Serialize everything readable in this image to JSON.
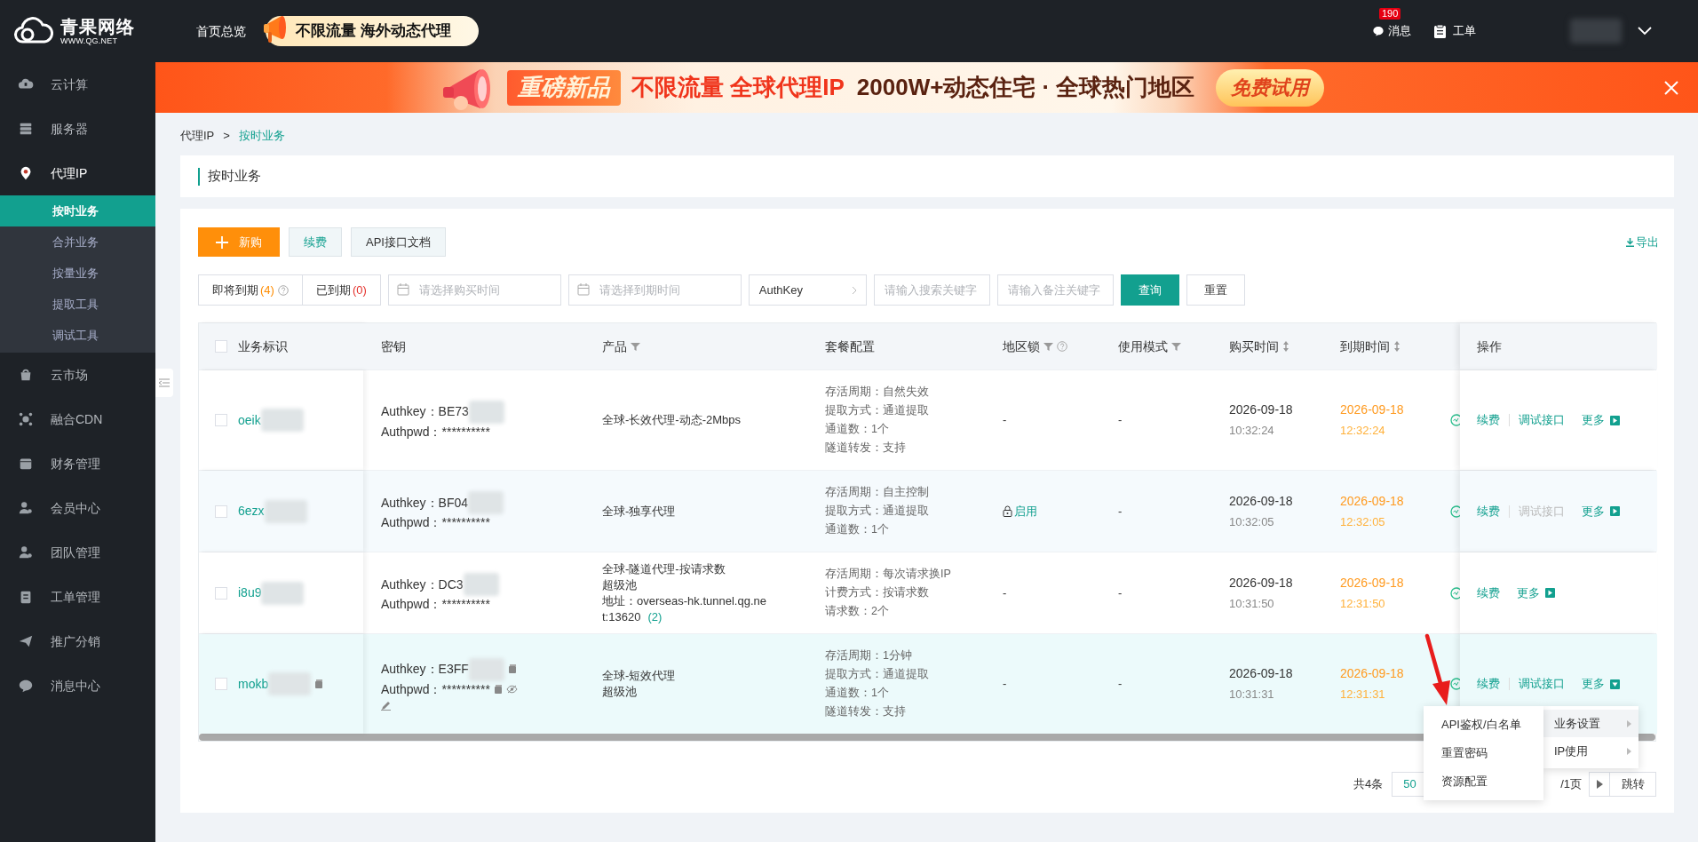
{
  "header": {
    "logo": {
      "name": "青果网络",
      "url": "WWW.QG.NET"
    },
    "nav": [
      {
        "label": "首页总览"
      }
    ],
    "promo": "不限流量 海外动态代理",
    "messages": {
      "label": "消息",
      "badge": "190"
    },
    "tickets": {
      "label": "工单"
    }
  },
  "sidebar": {
    "items": [
      {
        "label": "云计算",
        "selected": false
      },
      {
        "label": "服务器",
        "selected": false
      },
      {
        "label": "代理IP",
        "selected": true,
        "expanded": true,
        "children": [
          {
            "label": "按时业务",
            "selected": true
          },
          {
            "label": "合并业务",
            "selected": false
          },
          {
            "label": "按量业务",
            "selected": false
          },
          {
            "label": "提取工具",
            "selected": false
          },
          {
            "label": "调试工具",
            "selected": false
          }
        ]
      },
      {
        "label": "云市场",
        "selected": false
      },
      {
        "label": "融合CDN",
        "selected": false
      },
      {
        "label": "财务管理",
        "selected": false
      },
      {
        "label": "会员中心",
        "selected": false
      },
      {
        "label": "团队管理",
        "selected": false
      },
      {
        "label": "工单管理",
        "selected": false
      },
      {
        "label": "推广分销",
        "selected": false
      },
      {
        "label": "消息中心",
        "selected": false
      }
    ]
  },
  "banner": {
    "badge": "重磅新品",
    "highlight": "不限流量 全球代理IP",
    "text": "2000W+动态住宅 · 全球热门地区",
    "button": "免费试用"
  },
  "breadcrumb": {
    "items": [
      "代理IP",
      "按时业务"
    ],
    "separator": ">"
  },
  "page_title": "按时业务",
  "toolbar": {
    "buttons": [
      {
        "label": "新购",
        "kind": "primary"
      },
      {
        "label": "续费",
        "kind": "secondary"
      },
      {
        "label": "API接口文档",
        "kind": "default"
      }
    ],
    "export": "导出"
  },
  "filters": {
    "status_tabs": [
      {
        "label": "即将到期",
        "count": "(4)",
        "color": "#ff8c00",
        "help": true,
        "selected": false
      },
      {
        "label": "已到期",
        "count": "(0)",
        "color": "#e5322d",
        "help": false,
        "selected": false
      }
    ],
    "purchase_date": {
      "placeholder": "请选择购买时间"
    },
    "expire_date": {
      "placeholder": "请选择到期时间"
    },
    "search_type": "AuthKey",
    "keyword": {
      "placeholder": "请输入搜索关键字"
    },
    "remark": {
      "placeholder": "请输入备注关键字"
    },
    "buttons": [
      {
        "label": "查询",
        "kind": "primary"
      },
      {
        "label": "重置",
        "kind": "default"
      }
    ]
  },
  "table": {
    "all_checked": false,
    "columns": [
      {
        "label": "业务标识",
        "filter": false,
        "help": false,
        "sortable": false
      },
      {
        "label": "密钥",
        "filter": false,
        "help": false,
        "sortable": false
      },
      {
        "label": "产品",
        "filter": true,
        "help": false,
        "sortable": false
      },
      {
        "label": "套餐配置",
        "filter": false,
        "help": false,
        "sortable": false
      },
      {
        "label": "地区锁",
        "filter": true,
        "help": true,
        "sortable": false
      },
      {
        "label": "使用模式",
        "filter": true,
        "help": false,
        "sortable": false
      },
      {
        "label": "购买时间",
        "filter": false,
        "help": false,
        "sortable": true
      },
      {
        "label": "到期时间",
        "filter": false,
        "help": false,
        "sortable": true
      },
      {
        "label": "操作",
        "filter": false,
        "help": false,
        "sortable": false
      }
    ],
    "rows": [
      {
        "checked": false,
        "highlighted": false,
        "id": "oeik",
        "authkey": "Authkey：BE73",
        "authpwd": "Authpwd：**********",
        "copyable": false,
        "editable": false,
        "product": [
          "全球-长效代理-动态-2Mbps"
        ],
        "config": [
          "存活周期：自然失效",
          "提取方式：通道提取",
          "通道数：1个",
          "隧道转发：支持"
        ],
        "region_lock": {
          "text": "-",
          "locked": false
        },
        "mode": "-",
        "bought_date": "2026-09-18",
        "bought_time": "10:32:24",
        "expire_date": "2026-09-18",
        "expire_time": "12:32:24",
        "actions": [
          {
            "label": "续费",
            "kind": "link",
            "disabled": false
          },
          {
            "label": "调试接口",
            "kind": "link",
            "disabled": false
          },
          {
            "label": "更多",
            "kind": "more",
            "expanded": false
          }
        ]
      },
      {
        "checked": false,
        "highlighted": false,
        "id": "6ezx",
        "authkey": "Authkey：BF04",
        "authpwd": "Authpwd：**********",
        "copyable": false,
        "editable": false,
        "product": [
          "全球-独享代理"
        ],
        "config": [
          "存活周期：自主控制",
          "提取方式：通道提取",
          "通道数：1个"
        ],
        "region_lock": {
          "text": "启用",
          "locked": true
        },
        "mode": "-",
        "bought_date": "2026-09-18",
        "bought_time": "10:32:05",
        "expire_date": "2026-09-18",
        "expire_time": "12:32:05",
        "actions": [
          {
            "label": "续费",
            "kind": "link",
            "disabled": false
          },
          {
            "label": "调试接口",
            "kind": "link",
            "disabled": true
          },
          {
            "label": "更多",
            "kind": "more",
            "expanded": false
          }
        ]
      },
      {
        "checked": false,
        "highlighted": false,
        "id": "i8u9",
        "authkey": "Authkey：DC3",
        "authpwd": "Authpwd：**********",
        "copyable": false,
        "editable": false,
        "product": [
          "全球-隧道代理-按请求数",
          "超级池"
        ],
        "address": "地址：overseas-hk.tunnel.qg.net:13620",
        "address_count": "(2)",
        "config": [
          "存活周期：每次请求换IP",
          "计费方式：按请求数",
          "请求数：2个"
        ],
        "region_lock": {
          "text": "-",
          "locked": false
        },
        "mode": "-",
        "bought_date": "2026-09-18",
        "bought_time": "10:31:50",
        "expire_date": "2026-09-18",
        "expire_time": "12:31:50",
        "actions": [
          {
            "label": "续费",
            "kind": "link",
            "disabled": false
          },
          {
            "label": "更多",
            "kind": "more",
            "expanded": false
          }
        ]
      },
      {
        "checked": false,
        "highlighted": true,
        "id": "mokb",
        "authkey": "Authkey：E3FF",
        "authpwd": "Authpwd：**********",
        "copyable": true,
        "editable": true,
        "product": [
          "全球-短效代理",
          "超级池"
        ],
        "config": [
          "存活周期：1分钟",
          "提取方式：通道提取",
          "通道数：1个",
          "隧道转发：支持"
        ],
        "region_lock": {
          "text": "-",
          "locked": false
        },
        "mode": "-",
        "bought_date": "2026-09-18",
        "bought_time": "10:31:31",
        "expire_date": "2026-09-18",
        "expire_time": "12:31:31",
        "actions": [
          {
            "label": "续费",
            "kind": "link",
            "disabled": false
          },
          {
            "label": "调试接口",
            "kind": "link",
            "disabled": false
          },
          {
            "label": "更多",
            "kind": "more",
            "expanded": true
          }
        ]
      }
    ]
  },
  "pagination": {
    "total": "共4条",
    "page_size": "50",
    "pages": "/1页",
    "jump": "跳转"
  },
  "context_menu": {
    "categories": [
      {
        "label": "业务设置",
        "selected": true,
        "children": [
          {
            "label": "API鉴权/白名单"
          },
          {
            "label": "重置密码"
          },
          {
            "label": "资源配置"
          }
        ]
      },
      {
        "label": "IP使用",
        "selected": false
      }
    ]
  }
}
